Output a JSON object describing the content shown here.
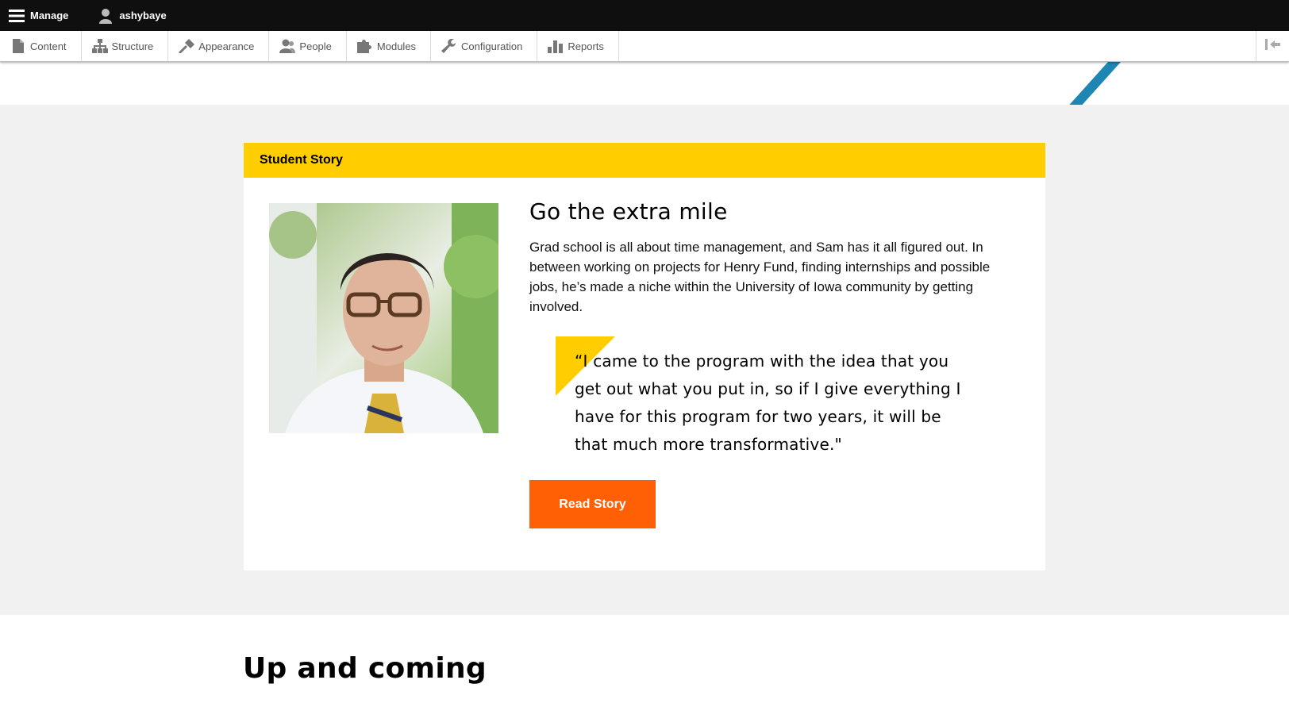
{
  "toolbar": {
    "manage_label": "Manage",
    "user_label": "ashybaye",
    "tray_items": [
      {
        "label": "Content",
        "icon": "file-icon"
      },
      {
        "label": "Structure",
        "icon": "sitemap-icon"
      },
      {
        "label": "Appearance",
        "icon": "paintbrush-icon"
      },
      {
        "label": "People",
        "icon": "people-icon"
      },
      {
        "label": "Modules",
        "icon": "puzzle-icon"
      },
      {
        "label": "Configuration",
        "icon": "wrench-icon"
      },
      {
        "label": "Reports",
        "icon": "bar-chart-icon"
      }
    ],
    "orientation_toggle_icon": "orientation-toggle-icon"
  },
  "colors": {
    "gold": "#ffcd00",
    "orange": "#ff5f05",
    "blue_accent": "#1d86b2",
    "toolbar_black": "#0f0f0f"
  },
  "card": {
    "header": "Student Story",
    "title": "Go the extra mile",
    "body": "Grad school is all about time management, and Sam has it all figured out. In between working on projects for Henry Fund, finding internships and possible jobs, he’s made a niche within the University of Iowa community by getting involved.",
    "quote": "“I came to the program with the idea that you get out what you put in, so if I give everything I have for this program for two years, it will be that much more transformative.\"",
    "button_label": "Read Story"
  },
  "next_section": {
    "title": "Up and coming"
  }
}
